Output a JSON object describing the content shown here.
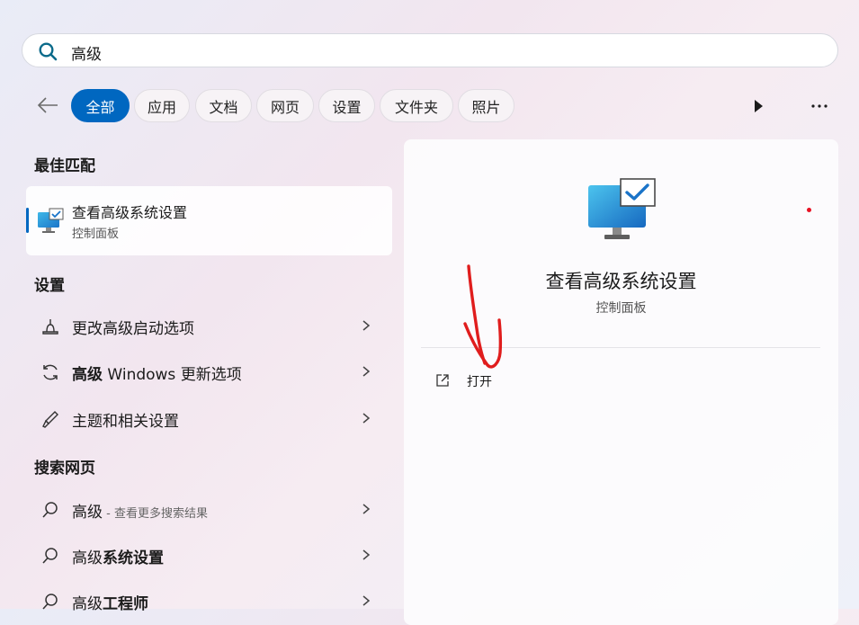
{
  "search": {
    "value": "高级"
  },
  "filters": [
    "全部",
    "应用",
    "文档",
    "网页",
    "设置",
    "文件夹",
    "照片"
  ],
  "sections": {
    "best_match": "最佳匹配",
    "settings": "设置",
    "web": "搜索网页"
  },
  "best_match": {
    "title": "查看高级系统设置",
    "subtitle": "控制面板"
  },
  "settings_items": [
    {
      "label": "更改高级启动选项"
    },
    {
      "bold": "高级",
      "rest": " Windows 更新选项"
    },
    {
      "label": "主题和相关设置"
    }
  ],
  "web_items": [
    {
      "bold": "高级",
      "sub": " - 查看更多搜索结果"
    },
    {
      "normal": "高级",
      "bold": "系统设置"
    },
    {
      "normal": "高级",
      "bold": "工程师"
    }
  ],
  "detail": {
    "title": "查看高级系统设置",
    "subtitle": "控制面板",
    "open_label": "打开"
  },
  "colors": {
    "accent": "#0067c0",
    "annotation": "#e01d1d"
  },
  "icons": {
    "search": "search-icon",
    "back": "back-arrow-icon",
    "play": "play-icon",
    "more": "more-icon",
    "monitor": "monitor-check-icon",
    "startup": "startup-options-icon",
    "update": "windows-update-icon",
    "theme": "brush-icon",
    "web_search": "search-icon",
    "chevron": "chevron-right-icon",
    "open": "open-external-icon"
  }
}
